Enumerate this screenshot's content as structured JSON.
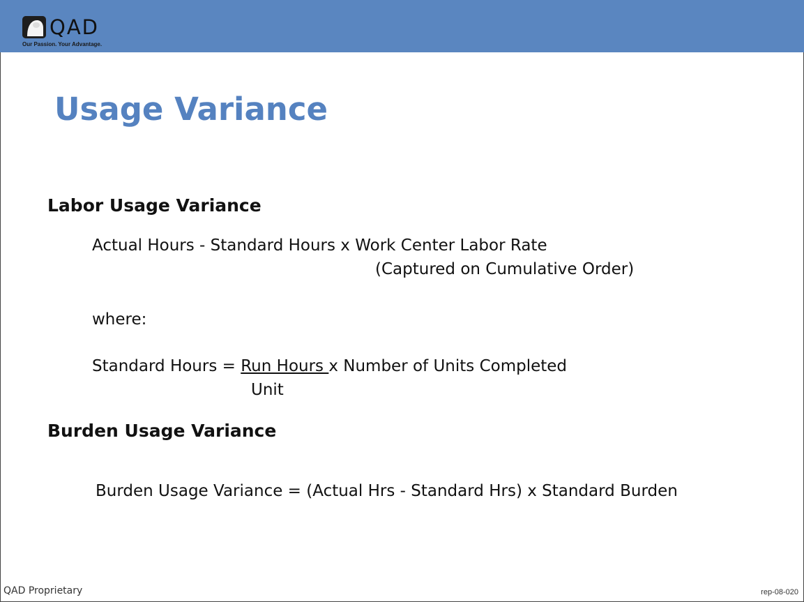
{
  "header": {
    "logo": {
      "wordmark": "QAD",
      "tagline": "Our Passion. Your Advantage."
    },
    "brand_color": "#5a86c0"
  },
  "slide": {
    "title": "Usage Variance",
    "title_color": "#5582c0",
    "sections": [
      {
        "heading": "Labor Usage Variance",
        "formula_line1": "Actual Hours - Standard Hours x Work Center Labor Rate",
        "formula_line2": "(Captured on Cumulative Order)",
        "where_label": "where:",
        "std_hours_prefix": "Standard Hours = ",
        "std_hours_numerator": "Run Hours ",
        "std_hours_suffix": "x Number of Units Completed",
        "std_hours_denominator": "Unit"
      },
      {
        "heading": "Burden Usage Variance",
        "formula": "Burden Usage Variance = (Actual Hrs - Standard Hrs) x Standard Burden"
      }
    ]
  },
  "footer": {
    "left": "QAD Proprietary",
    "right": "rep-08-020"
  }
}
